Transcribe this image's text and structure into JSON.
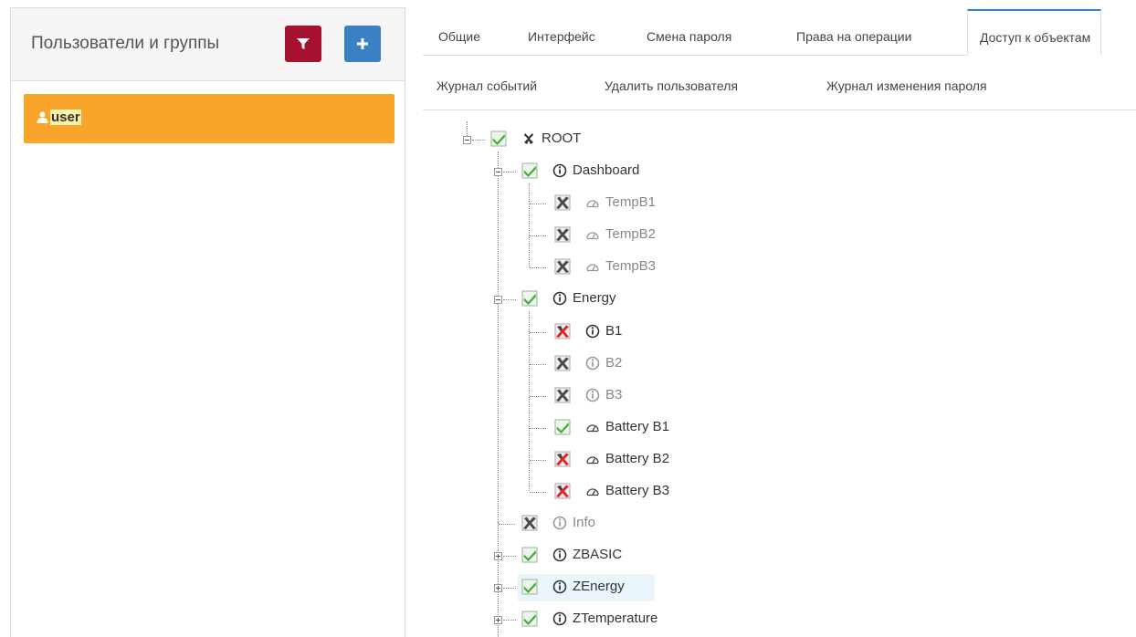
{
  "left_panel": {
    "title": "Пользователи и группы",
    "filter_icon": "filter-icon",
    "add_icon": "plus-icon",
    "users": [
      {
        "label": "user",
        "icon": "user-icon"
      }
    ]
  },
  "tabs": {
    "row1": [
      "Общие",
      "Интерфейс",
      "Смена пароля",
      "Права на операции",
      "Доступ к объектам"
    ],
    "row2": [
      "Журнал событий",
      "Удалить пользователя",
      "Журнал изменения пароля"
    ],
    "active": "Доступ к объектам"
  },
  "tree": {
    "root": {
      "label": "ROOT",
      "icon": "root-icon",
      "check": "checked"
    },
    "nodes": [
      {
        "label": "Dashboard",
        "icon": "info-icon",
        "check": "checked"
      },
      {
        "label": "TempB1",
        "icon": "gauge-icon",
        "check": "inherit-denied"
      },
      {
        "label": "TempB2",
        "icon": "gauge-icon",
        "check": "inherit-denied"
      },
      {
        "label": "TempB3",
        "icon": "gauge-icon",
        "check": "inherit-denied"
      },
      {
        "label": "Energy",
        "icon": "info-icon",
        "check": "checked"
      },
      {
        "label": "B1",
        "icon": "info-icon",
        "check": "denied"
      },
      {
        "label": "B2",
        "icon": "info-icon",
        "check": "inherit-denied"
      },
      {
        "label": "B3",
        "icon": "info-icon",
        "check": "inherit-denied"
      },
      {
        "label": "Battery B1",
        "icon": "gauge-icon",
        "check": "checked"
      },
      {
        "label": "Battery B2",
        "icon": "gauge-icon",
        "check": "denied"
      },
      {
        "label": "Battery B3",
        "icon": "gauge-icon",
        "check": "denied"
      },
      {
        "label": "Info",
        "icon": "info-icon",
        "check": "inherit-denied"
      },
      {
        "label": "ZBASIC",
        "icon": "info-icon",
        "check": "checked"
      },
      {
        "label": "ZEnergy",
        "icon": "info-icon",
        "check": "checked"
      },
      {
        "label": "ZTemperature",
        "icon": "info-icon",
        "check": "checked"
      }
    ],
    "selected": "ZEnergy"
  },
  "colors": {
    "filter_button": "#a5112e",
    "add_button": "#3a81c4",
    "user_item": "#f9a52b",
    "active_tab_border": "#3a81c4",
    "check_green": "#3cb034",
    "deny_red": "#e0242a",
    "inherit_dark": "#444444",
    "selected_node": "#e9f4fb"
  }
}
